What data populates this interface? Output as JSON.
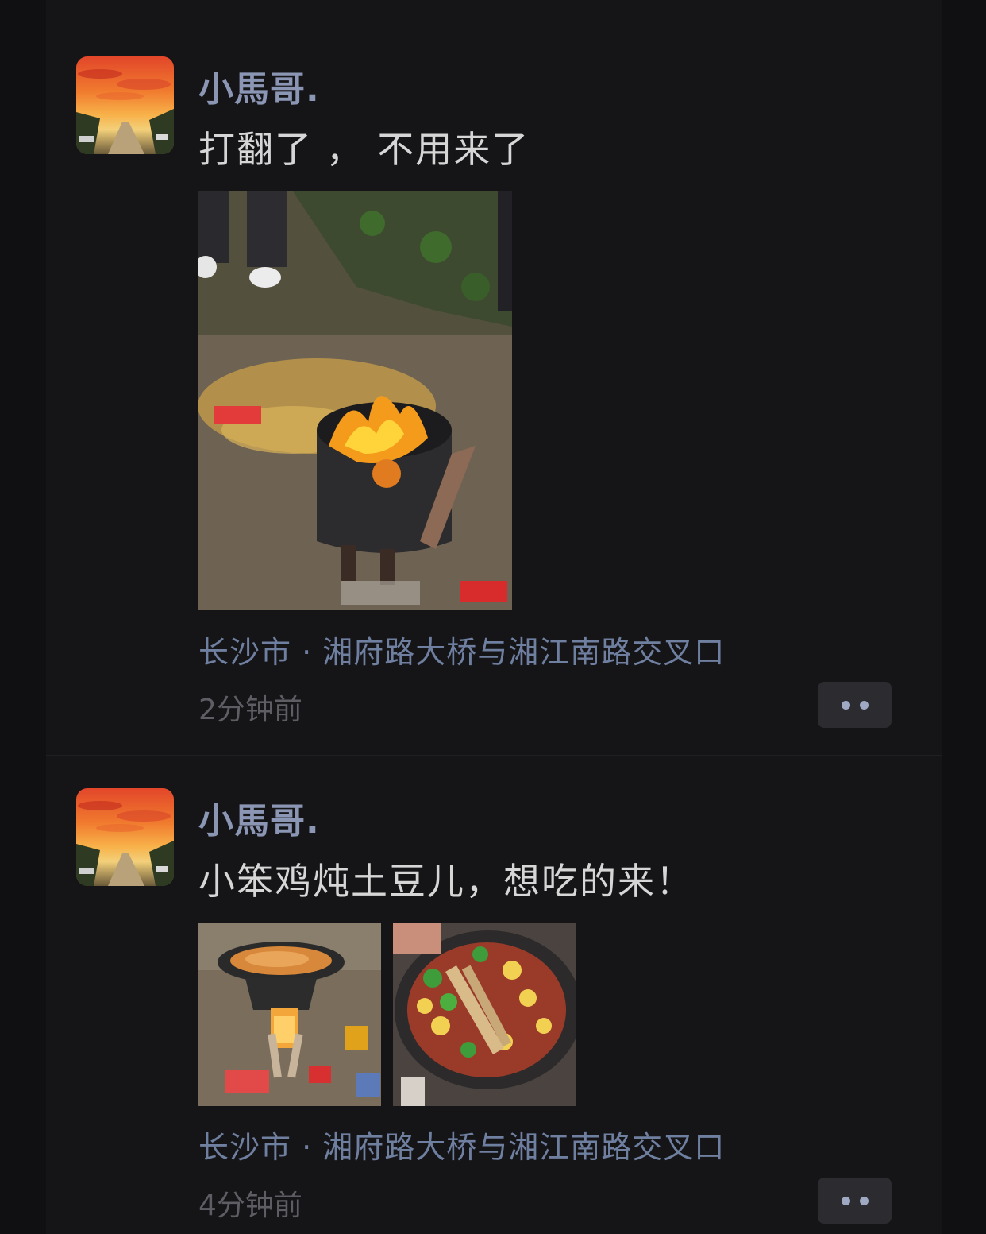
{
  "posts": [
    {
      "nickname": "小馬哥.",
      "content": "打翻了 ， 不用来了",
      "location": "长沙市 · 湘府路大桥与湘江南路交叉口",
      "time": "2分钟前",
      "images": [
        "overturned-pot-fire-photo"
      ]
    },
    {
      "nickname": "小馬哥.",
      "content": "小笨鸡炖土豆儿，想吃的来！",
      "location": "长沙市 · 湘府路大桥与湘江南路交叉口",
      "time": "4分钟前",
      "images": [
        "wok-on-firewood-photo",
        "chicken-potato-stew-photo"
      ]
    }
  ],
  "icons": {
    "more": "more-dots-icon"
  },
  "colors": {
    "background": "#101013",
    "card": "#151518",
    "nickname": "#8b96b4",
    "content": "#d6d6d6",
    "location": "#6f7fa0",
    "time": "#5d5d63",
    "more_button": "#2b2b30"
  }
}
